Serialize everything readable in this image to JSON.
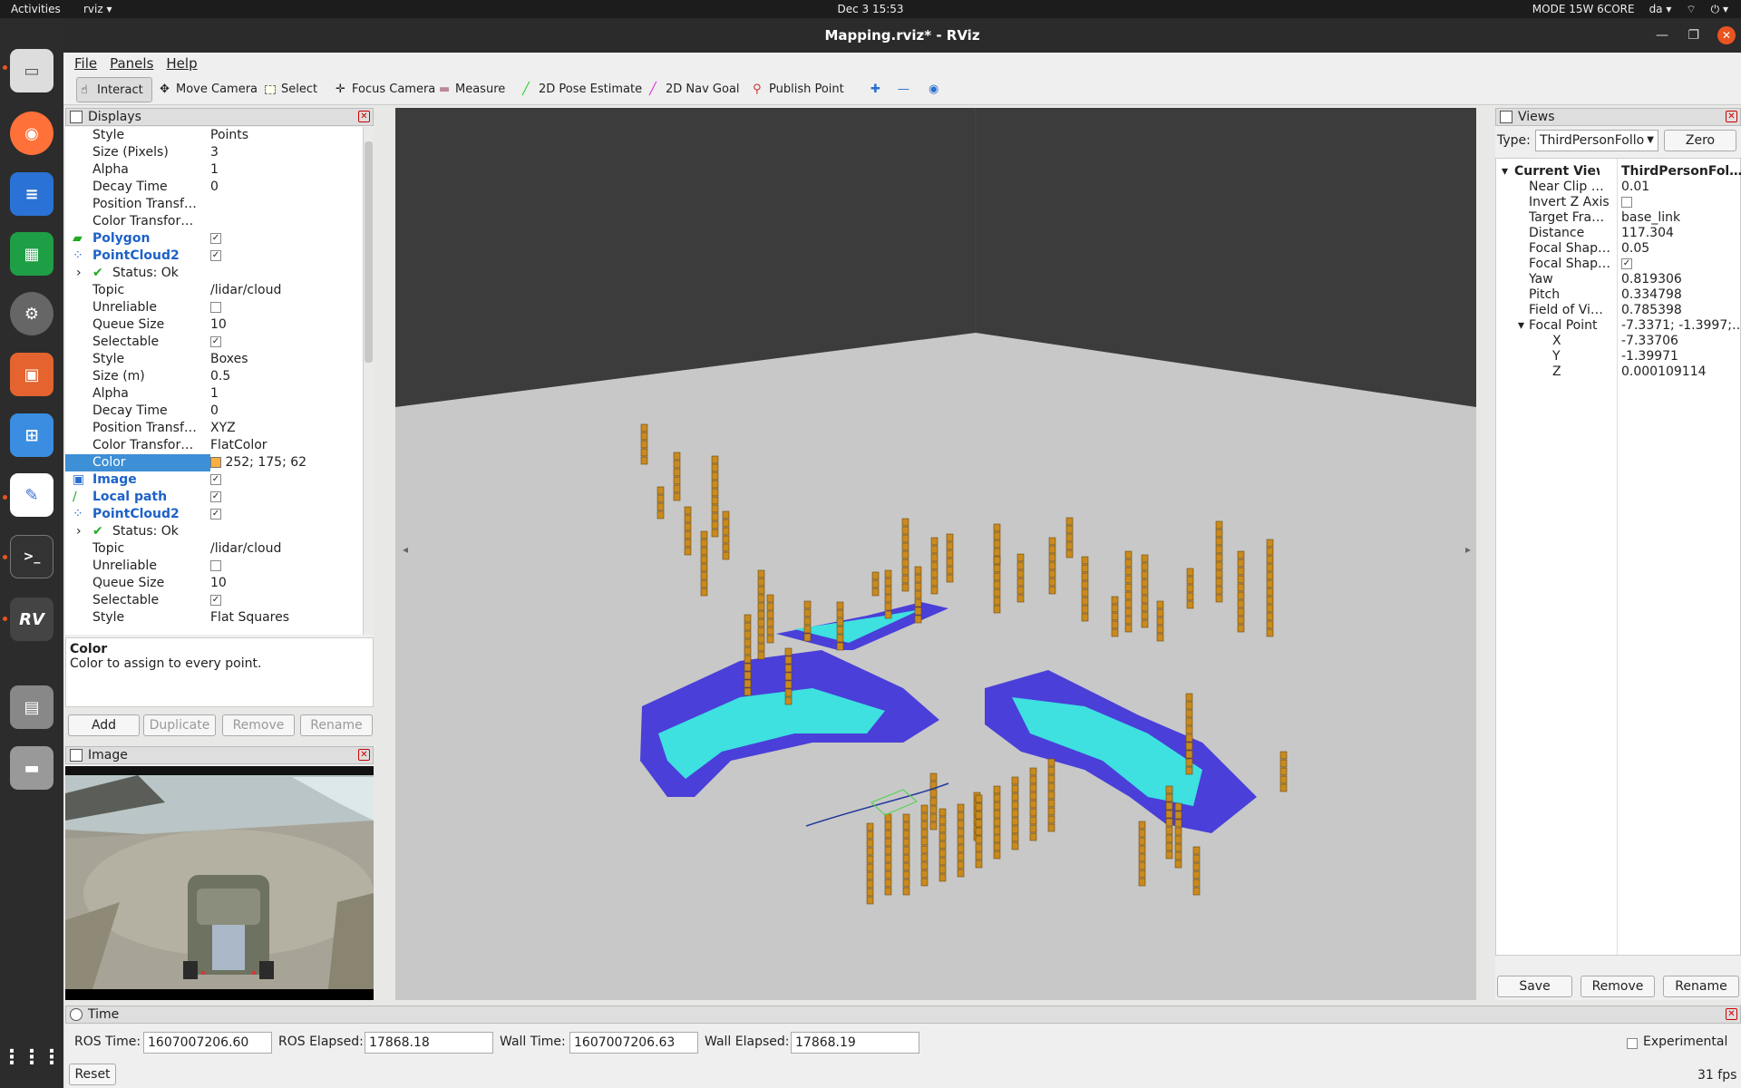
{
  "topbar": {
    "activities": "Activities",
    "app": "rviz ▾",
    "datetime": "Dec 3  15:53",
    "mode": "MODE 15W 6CORE",
    "lang": "da ▾",
    "power": "⏻ ▾"
  },
  "window": {
    "title": "Mapping.rviz* - RViz"
  },
  "menu": {
    "file": "File",
    "panels": "Panels",
    "help": "Help"
  },
  "toolbar": {
    "interact": "Interact",
    "move_camera": "Move Camera",
    "select": "Select",
    "focus_camera": "Focus Camera",
    "measure": "Measure",
    "pose_estimate": "2D Pose Estimate",
    "nav_goal": "2D Nav Goal",
    "publish_point": "Publish Point"
  },
  "displays": {
    "title": "Displays",
    "rows": [
      {
        "k": "Style",
        "v": "Points"
      },
      {
        "k": "Size (Pixels)",
        "v": "3"
      },
      {
        "k": "Alpha",
        "v": "1"
      },
      {
        "k": "Decay Time",
        "v": "0"
      },
      {
        "k": "Position Transf…",
        "v": ""
      },
      {
        "k": "Color Transfor…",
        "v": ""
      },
      {
        "k": "Polygon",
        "v": "✓"
      },
      {
        "k": "PointCloud2",
        "v": "✓"
      },
      {
        "k": "Status: Ok",
        "v": ""
      },
      {
        "k": "Topic",
        "v": "/lidar/cloud"
      },
      {
        "k": "Unreliable",
        "v": ""
      },
      {
        "k": "Queue Size",
        "v": "10"
      },
      {
        "k": "Selectable",
        "v": "✓"
      },
      {
        "k": "Style",
        "v": "Boxes"
      },
      {
        "k": "Size (m)",
        "v": "0.5"
      },
      {
        "k": "Alpha",
        "v": "1"
      },
      {
        "k": "Decay Time",
        "v": "0"
      },
      {
        "k": "Position Transf…",
        "v": "XYZ"
      },
      {
        "k": "Color Transfor…",
        "v": "FlatColor"
      },
      {
        "k": "Color",
        "v": "252; 175; 62"
      },
      {
        "k": "Image",
        "v": "✓"
      },
      {
        "k": "Local path",
        "v": "✓"
      },
      {
        "k": "PointCloud2",
        "v": "✓"
      },
      {
        "k": "Status: Ok",
        "v": ""
      },
      {
        "k": "Topic",
        "v": "/lidar/cloud"
      },
      {
        "k": "Unreliable",
        "v": ""
      },
      {
        "k": "Queue Size",
        "v": "10"
      },
      {
        "k": "Selectable",
        "v": "✓"
      },
      {
        "k": "Style",
        "v": "Flat Squares"
      }
    ],
    "desc_title": "Color",
    "desc_text": "Color to assign to every point.",
    "add": "Add",
    "duplicate": "Duplicate",
    "remove": "Remove",
    "rename": "Rename",
    "color_swatch": "#fcaf3e"
  },
  "image_panel": {
    "title": "Image"
  },
  "views": {
    "title": "Views",
    "type_label": "Type:",
    "type_value": "ThirdPersonFollo",
    "zero": "Zero",
    "rows": [
      {
        "k": "Current View",
        "v": "ThirdPersonFol…"
      },
      {
        "k": "Near Clip …",
        "v": "0.01"
      },
      {
        "k": "Invert Z Axis",
        "v": ""
      },
      {
        "k": "Target Fra…",
        "v": "base_link"
      },
      {
        "k": "Distance",
        "v": "117.304"
      },
      {
        "k": "Focal Shap…",
        "v": "0.05"
      },
      {
        "k": "Focal Shap…",
        "v": "✓"
      },
      {
        "k": "Yaw",
        "v": "0.819306"
      },
      {
        "k": "Pitch",
        "v": "0.334798"
      },
      {
        "k": "Field of Vi…",
        "v": "0.785398"
      },
      {
        "k": "Focal Point",
        "v": "-7.3371; -1.3997;…"
      },
      {
        "k": "X",
        "v": "-7.33706"
      },
      {
        "k": "Y",
        "v": "-1.39971"
      },
      {
        "k": "Z",
        "v": "0.000109114"
      }
    ],
    "save": "Save",
    "remove": "Remove",
    "rename": "Rename"
  },
  "time": {
    "title": "Time",
    "ros_time_label": "ROS Time:",
    "ros_time": "1607007206.60",
    "ros_elapsed_label": "ROS Elapsed:",
    "ros_elapsed": "17868.18",
    "wall_time_label": "Wall Time:",
    "wall_time": "1607007206.63",
    "wall_elapsed_label": "Wall Elapsed:",
    "wall_elapsed": "17868.19",
    "experimental": "Experimental",
    "reset": "Reset",
    "fps": "31 fps"
  }
}
